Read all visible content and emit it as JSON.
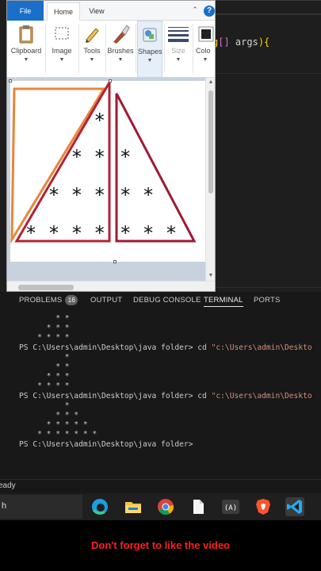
{
  "paint": {
    "tabs": {
      "file": "File",
      "home": "Home",
      "view": "View"
    },
    "help_label": "?",
    "ribbon": [
      {
        "name": "clipboard",
        "label": "Clipboard",
        "disabled": false
      },
      {
        "name": "image",
        "label": "Image",
        "disabled": false
      },
      {
        "name": "tools",
        "label": "Tools",
        "disabled": false
      },
      {
        "name": "brushes",
        "label": "Brushes",
        "disabled": false
      },
      {
        "name": "shapes",
        "label": "Shapes",
        "disabled": false
      },
      {
        "name": "size",
        "label": "Size",
        "disabled": true
      },
      {
        "name": "colors",
        "label": "Colo"
      }
    ],
    "drawing": {
      "rows": [
        {
          "left": "*",
          "right": ""
        },
        {
          "left": "* *",
          "right": "*"
        },
        {
          "left": "* * *",
          "right": "* *"
        },
        {
          "left": "* * * *",
          "right": "* * *"
        }
      ],
      "colors": {
        "outer_triangle": "#e8853a",
        "left_triangle": "#b22234",
        "right_triangle": "#9e1b32"
      }
    }
  },
  "editor": {
    "code_fragment": "g[] args){"
  },
  "panel": {
    "tabs": [
      {
        "label": "PROBLEMS",
        "badge": "16"
      },
      {
        "label": "OUTPUT"
      },
      {
        "label": "DEBUG CONSOLE"
      },
      {
        "label": "TERMINAL",
        "active": true
      },
      {
        "label": "PORTS"
      }
    ],
    "terminal_lines": [
      {
        "text": "        * *"
      },
      {
        "text": "      * * *"
      },
      {
        "text": "    * * * *"
      },
      {
        "prompt": "PS C:\\Users\\admin\\Desktop\\java folder> cd ",
        "quoted": "\"c:\\Users\\admin\\Deskto"
      },
      {
        "text": "          *"
      },
      {
        "text": "        * *"
      },
      {
        "text": "      * * *"
      },
      {
        "text": "    * * * *"
      },
      {
        "prompt": "PS C:\\Users\\admin\\Desktop\\java folder> cd ",
        "quoted": "\"c:\\Users\\admin\\Deskto"
      },
      {
        "text": "          *"
      },
      {
        "text": "        * * *"
      },
      {
        "text": "      * * * * *"
      },
      {
        "text": "    * * * * * * *"
      },
      {
        "prompt": "PS C:\\Users\\admin\\Desktop\\java folder>"
      }
    ]
  },
  "status_bar": {
    "text": "eady"
  },
  "taskbar": {
    "search_text": "h",
    "apps": [
      "edge-icon",
      "file-explorer-icon",
      "chrome-icon",
      "file-icon",
      "vscode-remote-icon",
      "brave-icon",
      "vscode-icon"
    ]
  },
  "caption": "Don't forget to like the video"
}
